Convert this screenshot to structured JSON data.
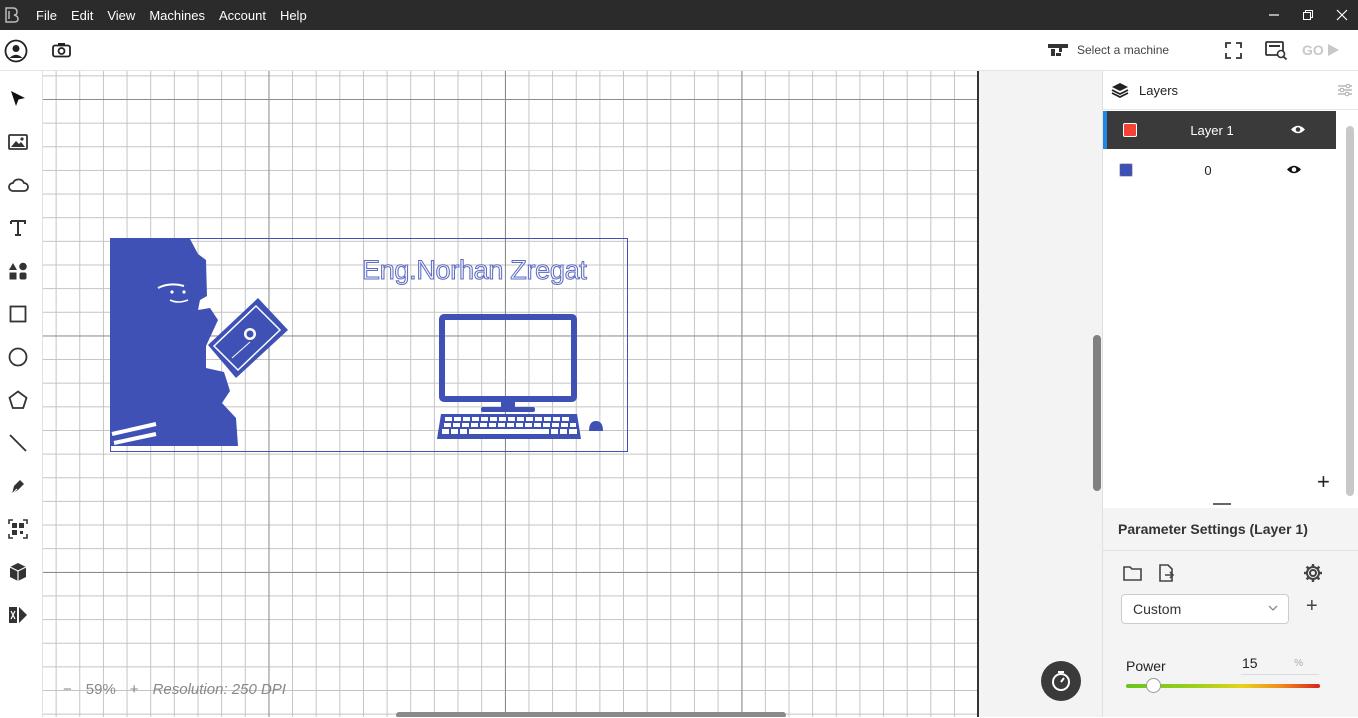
{
  "menu": {
    "items": [
      "File",
      "Edit",
      "View",
      "Machines",
      "Account",
      "Help"
    ]
  },
  "toolbar": {
    "select_machine": "Select a machine",
    "go_label": "GO"
  },
  "canvas": {
    "title_text": "Eng.Norhan Zregat",
    "zoom": "59%",
    "zoom_minus": "−",
    "zoom_plus": "+",
    "resolution": "Resolution: 250 DPI"
  },
  "layers": {
    "title": "Layers",
    "add_label": "+",
    "items": [
      {
        "name": "Layer 1",
        "color": "#f44336",
        "active": true
      },
      {
        "name": "0",
        "color": "#3f51b5",
        "active": false
      }
    ]
  },
  "params": {
    "title": "Parameter Settings (Layer 1)",
    "preset": "Custom",
    "add_label": "+",
    "power_label": "Power",
    "power_value": "15",
    "power_unit": "%",
    "power_fraction": 0.15
  },
  "icons": {
    "left_tools": [
      "cursor-icon",
      "image-icon",
      "cloud-icon",
      "text-icon",
      "elements-icon",
      "rectangle-icon",
      "ellipse-icon",
      "polygon-icon",
      "line-icon",
      "pen-icon",
      "qr-icon",
      "box-icon",
      "dxf-icon"
    ],
    "accent": "#3f51b5"
  }
}
